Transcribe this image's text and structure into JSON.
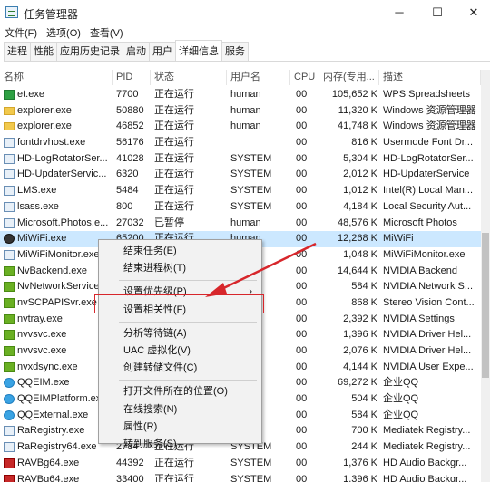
{
  "window": {
    "title": "任务管理器",
    "minimize": "─",
    "maximize": "☐",
    "close": "✕"
  },
  "menu": [
    "文件(F)",
    "选项(O)",
    "查看(V)"
  ],
  "tabs": [
    "进程",
    "性能",
    "应用历史记录",
    "启动",
    "用户",
    "详细信息",
    "服务"
  ],
  "active_tab": "详细信息",
  "columns": {
    "name": "名称",
    "pid": "PID",
    "status": "状态",
    "user": "用户名",
    "cpu": "CPU",
    "mem": "内存(专用...",
    "desc": "描述"
  },
  "rows": [
    {
      "icon": "green",
      "name": "et.exe",
      "pid": "7700",
      "status": "正在运行",
      "user": "human",
      "cpu": "00",
      "mem": "105,652 K",
      "desc": "WPS Spreadsheets"
    },
    {
      "icon": "folder",
      "name": "explorer.exe",
      "pid": "50880",
      "status": "正在运行",
      "user": "human",
      "cpu": "00",
      "mem": "11,320 K",
      "desc": "Windows 资源管理器"
    },
    {
      "icon": "folder",
      "name": "explorer.exe",
      "pid": "46852",
      "status": "正在运行",
      "user": "human",
      "cpu": "00",
      "mem": "41,748 K",
      "desc": "Windows 资源管理器"
    },
    {
      "icon": "box",
      "name": "fontdrvhost.exe",
      "pid": "56176",
      "status": "正在运行",
      "user": "",
      "cpu": "00",
      "mem": "816 K",
      "desc": "Usermode Font Dr..."
    },
    {
      "icon": "box",
      "name": "HD-LogRotatorSer...",
      "pid": "41028",
      "status": "正在运行",
      "user": "SYSTEM",
      "cpu": "00",
      "mem": "5,304 K",
      "desc": "HD-LogRotatorSer..."
    },
    {
      "icon": "box",
      "name": "HD-UpdaterServic...",
      "pid": "6320",
      "status": "正在运行",
      "user": "SYSTEM",
      "cpu": "00",
      "mem": "2,012 K",
      "desc": "HD-UpdaterService"
    },
    {
      "icon": "box",
      "name": "LMS.exe",
      "pid": "5484",
      "status": "正在运行",
      "user": "SYSTEM",
      "cpu": "00",
      "mem": "1,012 K",
      "desc": "Intel(R) Local Man..."
    },
    {
      "icon": "box",
      "name": "lsass.exe",
      "pid": "800",
      "status": "正在运行",
      "user": "SYSTEM",
      "cpu": "00",
      "mem": "4,184 K",
      "desc": "Local Security Aut..."
    },
    {
      "icon": "box",
      "name": "Microsoft.Photos.e...",
      "pid": "27032",
      "status": "已暂停",
      "user": "human",
      "cpu": "00",
      "mem": "48,576 K",
      "desc": "Microsoft Photos"
    },
    {
      "icon": "dark",
      "name": "MiWiFi.exe",
      "pid": "65200",
      "status": "正在运行",
      "user": "human",
      "cpu": "00",
      "mem": "12,268 K",
      "desc": "MiWiFi",
      "selected": true
    },
    {
      "icon": "box",
      "name": "MiWiFiMonitor.exe",
      "pid": "",
      "status": "",
      "user": "",
      "cpu": "00",
      "mem": "1,048 K",
      "desc": "MiWiFiMonitor.exe"
    },
    {
      "icon": "nv",
      "name": "NvBackend.exe",
      "pid": "",
      "status": "",
      "user": "",
      "cpu": "00",
      "mem": "14,644 K",
      "desc": "NVIDIA Backend"
    },
    {
      "icon": "nv",
      "name": "NvNetworkService",
      "pid": "",
      "status": "",
      "user": "",
      "cpu": "00",
      "mem": "584 K",
      "desc": "NVIDIA Network S..."
    },
    {
      "icon": "nv",
      "name": "nvSCPAPISvr.exe",
      "pid": "",
      "status": "",
      "user": "",
      "cpu": "00",
      "mem": "868 K",
      "desc": "Stereo Vision Cont..."
    },
    {
      "icon": "nv",
      "name": "nvtray.exe",
      "pid": "",
      "status": "",
      "user": "",
      "cpu": "00",
      "mem": "2,392 K",
      "desc": "NVIDIA Settings"
    },
    {
      "icon": "nv",
      "name": "nvvsvc.exe",
      "pid": "",
      "status": "",
      "user": "",
      "cpu": "00",
      "mem": "1,396 K",
      "desc": "NVIDIA Driver Hel..."
    },
    {
      "icon": "nv",
      "name": "nvvsvc.exe",
      "pid": "",
      "status": "",
      "user": "",
      "cpu": "00",
      "mem": "2,076 K",
      "desc": "NVIDIA Driver Hel..."
    },
    {
      "icon": "nv",
      "name": "nvxdsync.exe",
      "pid": "",
      "status": "",
      "user": "",
      "cpu": "00",
      "mem": "4,144 K",
      "desc": "NVIDIA User Expe..."
    },
    {
      "icon": "qq",
      "name": "QQEIM.exe",
      "pid": "",
      "status": "",
      "user": "",
      "cpu": "00",
      "mem": "69,272 K",
      "desc": "企业QQ"
    },
    {
      "icon": "qq",
      "name": "QQEIMPlatform.exe",
      "pid": "",
      "status": "",
      "user": "",
      "cpu": "00",
      "mem": "504 K",
      "desc": "企业QQ"
    },
    {
      "icon": "qq",
      "name": "QQExternal.exe",
      "pid": "",
      "status": "",
      "user": "",
      "cpu": "00",
      "mem": "584 K",
      "desc": "企业QQ"
    },
    {
      "icon": "box",
      "name": "RaRegistry.exe",
      "pid": "",
      "status": "",
      "user": "",
      "cpu": "00",
      "mem": "700 K",
      "desc": "Mediatek Registry..."
    },
    {
      "icon": "box",
      "name": "RaRegistry64.exe",
      "pid": "2784",
      "status": "正在运行",
      "user": "SYSTEM",
      "cpu": "00",
      "mem": "244 K",
      "desc": "Mediatek Registry..."
    },
    {
      "icon": "red",
      "name": "RAVBg64.exe",
      "pid": "44392",
      "status": "正在运行",
      "user": "SYSTEM",
      "cpu": "00",
      "mem": "1,376 K",
      "desc": "HD Audio Backgr..."
    },
    {
      "icon": "red",
      "name": "RAVBg64.exe",
      "pid": "33400",
      "status": "正在运行",
      "user": "SYSTEM",
      "cpu": "00",
      "mem": "1,396 K",
      "desc": "HD Audio Backgr..."
    }
  ],
  "context_menu": [
    {
      "label": "结束任务(E)"
    },
    {
      "label": "结束进程树(T)"
    },
    {
      "sep": true
    },
    {
      "label": "设置优先级(P)",
      "arrow": "›"
    },
    {
      "label": "设置相关性(F)",
      "highlight": true
    },
    {
      "sep": true
    },
    {
      "label": "分析等待链(A)"
    },
    {
      "label": "UAC 虚拟化(V)"
    },
    {
      "label": "创建转储文件(C)"
    },
    {
      "sep": true
    },
    {
      "label": "打开文件所在的位置(O)"
    },
    {
      "label": "在线搜索(N)"
    },
    {
      "label": "属性(R)"
    },
    {
      "label": "转到服务(S)"
    }
  ],
  "accent_colors": {
    "selected_row": "#cce8ff",
    "annotation": "#d7262b"
  }
}
